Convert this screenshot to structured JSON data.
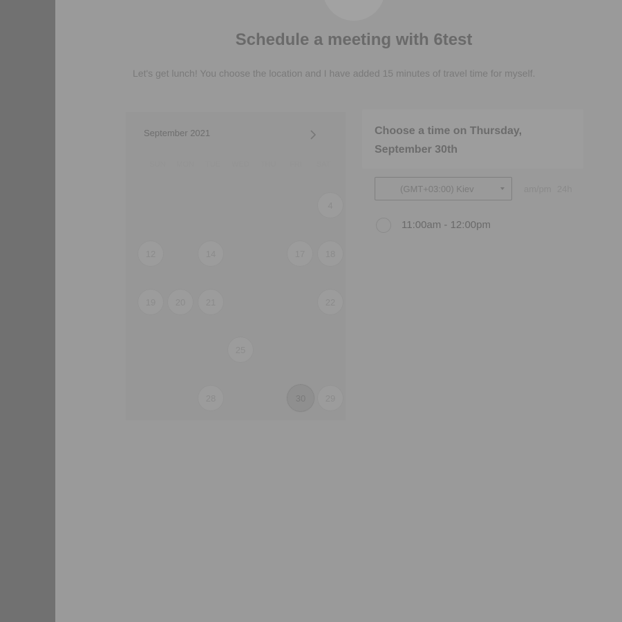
{
  "page": {
    "title": "Schedule a meeting with 6test",
    "description": "Let's get lunch! You choose the location and I have added 15 minutes of travel time for myself."
  },
  "calendar": {
    "month_label": "September 2021",
    "next_icon": "chevron-right-icon",
    "weekdays": [
      "SUN",
      "MON",
      "TUE",
      "WED",
      "THU",
      "FRI",
      "SAT"
    ],
    "days": [
      {
        "label": "4",
        "state": "available"
      },
      {
        "label": "12",
        "state": "available"
      },
      {
        "label": "14",
        "state": "available"
      },
      {
        "label": "17",
        "state": "available"
      },
      {
        "label": "18",
        "state": "available"
      },
      {
        "label": "19",
        "state": "available"
      },
      {
        "label": "20",
        "state": "available"
      },
      {
        "label": "21",
        "state": "available"
      },
      {
        "label": "22",
        "state": "available"
      },
      {
        "label": "25",
        "state": "available"
      },
      {
        "label": "28",
        "state": "available"
      },
      {
        "label": "29",
        "state": "available"
      },
      {
        "label": "30",
        "state": "selected"
      }
    ]
  },
  "times": {
    "heading": "Choose a time on Thursday, September 30th",
    "timezone": "(GMT+03:00) Kiev",
    "format_ampm": "am/pm",
    "format_24h": "24h",
    "slots": [
      "11:00am - 12:00pm"
    ]
  },
  "colors": {
    "overlay_bg": "#9a9a9a",
    "rail_bg": "#717171"
  }
}
